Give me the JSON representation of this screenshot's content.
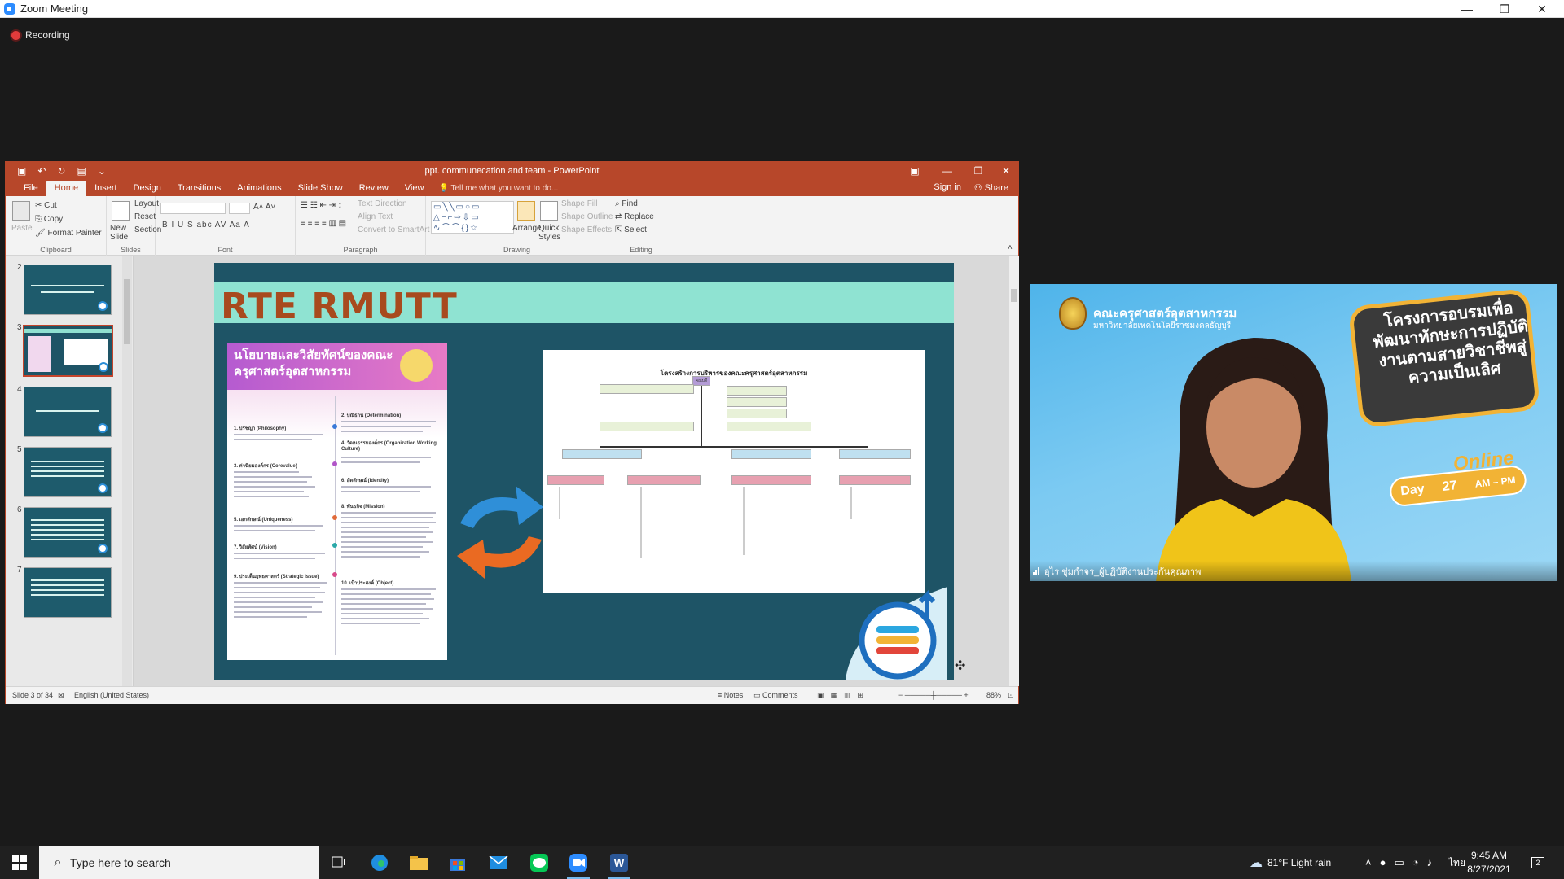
{
  "zoom": {
    "title": "Zoom Meeting",
    "recording_label": "Recording",
    "window_controls": {
      "minimize": "—",
      "restore": "❐",
      "close": "✕"
    }
  },
  "ppt": {
    "title": "ppt. communecation and team - PowerPoint",
    "tabs": [
      "File",
      "Home",
      "Insert",
      "Design",
      "Transitions",
      "Animations",
      "Slide Show",
      "Review",
      "View"
    ],
    "active_tab": "Home",
    "tell_me": "Tell me what you want to do...",
    "sign_in": "Sign in",
    "share": "Share",
    "ribbon": {
      "clipboard": {
        "label": "Clipboard",
        "paste": "Paste",
        "cut": "Cut",
        "copy": "Copy",
        "format_painter": "Format Painter"
      },
      "slides": {
        "label": "Slides",
        "new_slide": "New Slide",
        "layout": "Layout",
        "reset": "Reset",
        "section": "Section"
      },
      "font": {
        "label": "Font",
        "buttons": "B   I   U   S   abc   AV   Aa   A"
      },
      "paragraph": {
        "label": "Paragraph",
        "text_direction": "Text Direction",
        "align_text": "Align Text",
        "convert": "Convert to SmartArt"
      },
      "drawing": {
        "label": "Drawing",
        "shapes_glyphs": "▭╲╲▭○▭ △⌐⌐⇨⇩▭ ∿⌒⌒{}☆",
        "arrange": "Arrange",
        "quick_styles": "Quick Styles",
        "shape_fill": "Shape Fill",
        "shape_outline": "Shape Outline",
        "shape_effects": "Shape Effects"
      },
      "editing": {
        "label": "Editing",
        "find": "Find",
        "replace": "Replace",
        "select": "Select"
      }
    },
    "thumbnails": [
      {
        "num": "2"
      },
      {
        "num": "3"
      },
      {
        "num": "4"
      },
      {
        "num": "5"
      },
      {
        "num": "6"
      },
      {
        "num": "7"
      }
    ],
    "slide": {
      "title": "RTE RMUTT",
      "poster_heading": "นโยบายและวิสัยทัศน์ของคณะครุศาสตร์อุตสาหกรรม",
      "poster_sections": [
        "1. ปรัชญา (Philosophy)",
        "2. ปณิธาน (Determination)",
        "3. ค่านิยมองค์กร (Corevalue)",
        "4. วัฒนธรรมองค์กร (Organization Working Culture)",
        "5. เอกลักษณ์ (Uniqueness)",
        "6. อัตลักษณ์ (Identity)",
        "7. วิสัยทัศน์ (Vision)",
        "8. พันธกิจ (Mission)",
        "9. ประเด็นยุทธศาสตร์ (Strategic Issue)",
        "10. เป้าประสงค์ (Object)"
      ],
      "org_title": "โครงสร้างการบริหารของคณะครุศาสตร์อุตสาหกรรม",
      "org_top": "คณบดี"
    },
    "status": {
      "slide_of": "Slide 3 of 34",
      "language": "English (United States)",
      "notes": "Notes",
      "comments": "Comments",
      "zoom": "88%"
    }
  },
  "video": {
    "org_line1": "คณะครุศาสตร์อุตสาหกรรม",
    "org_line2": "มหาวิทยาลัยเทคโนโลยีราชมงคลธัญบุรี",
    "bubble_text": "โครงการอบรมเพื่อพัฒนาทักษะการปฏิบัติงานตามสายวิชาชีพสู่ความเป็นเลิศ",
    "online": "Online",
    "day_label": "Day",
    "day_number": "27",
    "time_range": "AM – PM",
    "participant_name": "อุไร ชุ่มกำจร_ผู้ปฏิบัติงานประกันคุณภาพ"
  },
  "taskbar": {
    "search_placeholder": "Type here to search",
    "weather": "81°F  Light rain",
    "input_lang": "ไทย",
    "time": "9:45 AM",
    "date": "8/27/2021",
    "notification_count": "2"
  },
  "colors": {
    "ppt_accent": "#b7472a",
    "zoom_blue": "#2d8cff",
    "slide_bg": "#1e5466",
    "slide_band": "#8fe3d2",
    "slide_title": "#a84a1e"
  }
}
